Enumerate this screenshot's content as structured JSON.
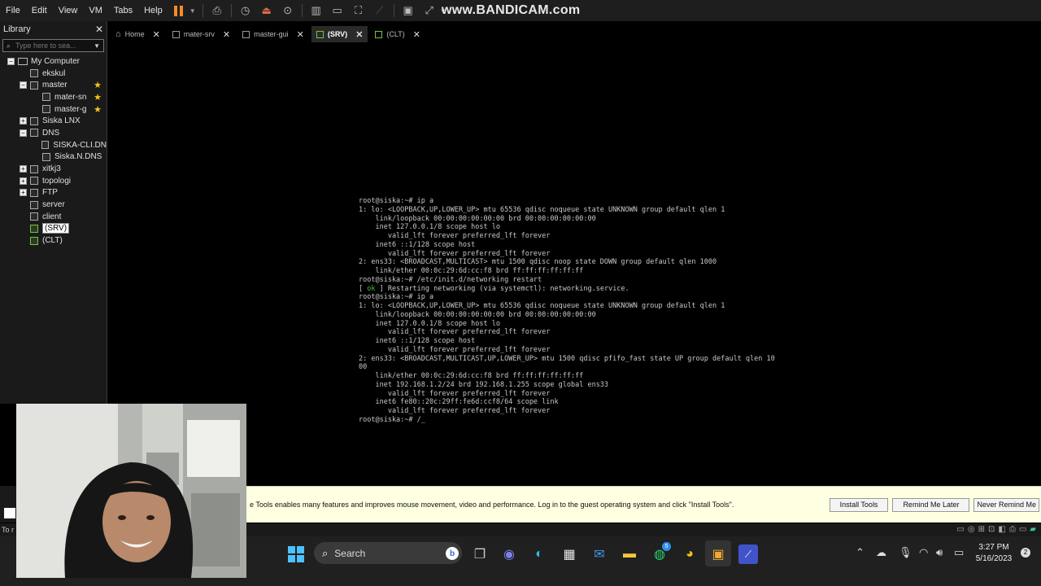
{
  "menubar": {
    "items": [
      "File",
      "Edit",
      "View",
      "VM",
      "Tabs",
      "Help"
    ],
    "watermark": "www.BANDICAM.com"
  },
  "library": {
    "title": "Library",
    "search_placeholder": "Type here to sea...",
    "tree": [
      {
        "label": "My Computer",
        "level": 0,
        "expander": "−",
        "icon": "computer-icon"
      },
      {
        "label": "ekskul",
        "level": 1,
        "expander": "",
        "icon": "vm-icon"
      },
      {
        "label": "master",
        "level": 1,
        "expander": "−",
        "icon": "vm-icon",
        "star": true
      },
      {
        "label": "mater-sn",
        "level": 2,
        "expander": "",
        "icon": "vm-icon",
        "star": true
      },
      {
        "label": "master-g",
        "level": 2,
        "expander": "",
        "icon": "vm-icon",
        "star": true
      },
      {
        "label": "Siska LNX",
        "level": 1,
        "expander": "+",
        "icon": "vm-icon"
      },
      {
        "label": "DNS",
        "level": 1,
        "expander": "−",
        "icon": "vm-icon"
      },
      {
        "label": "SISKA-CLI.DN",
        "level": 2,
        "expander": "",
        "icon": "vm-icon"
      },
      {
        "label": "Siska.N.DNS",
        "level": 2,
        "expander": "",
        "icon": "vm-icon"
      },
      {
        "label": "xitkj3",
        "level": 1,
        "expander": "+",
        "icon": "vm-icon"
      },
      {
        "label": "topologi",
        "level": 1,
        "expander": "+",
        "icon": "vm-icon"
      },
      {
        "label": "FTP",
        "level": 1,
        "expander": "+",
        "icon": "vm-icon"
      },
      {
        "label": "server",
        "level": 1,
        "expander": "",
        "icon": "vm-icon"
      },
      {
        "label": "client",
        "level": 1,
        "expander": "",
        "icon": "vm-icon"
      },
      {
        "label": "(SRV)",
        "level": 1,
        "expander": "",
        "icon": "vm-running-icon",
        "selected": true
      },
      {
        "label": "(CLT)",
        "level": 1,
        "expander": "",
        "icon": "vm-running-icon"
      }
    ]
  },
  "tabs": [
    {
      "label": "Home",
      "icon": "home-icon",
      "active": false
    },
    {
      "label": "mater-srv",
      "icon": "vm-icon",
      "active": false
    },
    {
      "label": "master-gui",
      "icon": "vm-icon",
      "active": false
    },
    {
      "label": "(SRV)",
      "icon": "vm-running-icon",
      "active": true
    },
    {
      "label": "(CLT)",
      "icon": "vm-running-icon",
      "active": false
    }
  ],
  "console": {
    "lines": [
      "root@siska:~# ip a",
      "1: lo: <LOOPBACK,UP,LOWER_UP> mtu 65536 qdisc noqueue state UNKNOWN group default qlen 1",
      "    link/loopback 00:00:00:00:00:00 brd 00:00:00:00:00:00",
      "    inet 127.0.0.1/8 scope host lo",
      "       valid_lft forever preferred_lft forever",
      "    inet6 ::1/128 scope host",
      "       valid_lft forever preferred_lft forever",
      "2: ens33: <BROADCAST,MULTICAST> mtu 1500 qdisc noop state DOWN group default qlen 1000",
      "    link/ether 00:0c:29:6d:cc:f8 brd ff:ff:ff:ff:ff:ff",
      "root@siska:~# /etc/init.d/networking restart",
      "[ ok ] Restarting networking (via systemctl): networking.service.",
      "root@siska:~# ip a",
      "1: lo: <LOOPBACK,UP,LOWER_UP> mtu 65536 qdisc noqueue state UNKNOWN group default qlen 1",
      "    link/loopback 00:00:00:00:00:00 brd 00:00:00:00:00:00",
      "    inet 127.0.0.1/8 scope host lo",
      "       valid_lft forever preferred_lft forever",
      "    inet6 ::1/128 scope host",
      "       valid_lft forever preferred_lft forever",
      "2: ens33: <BROADCAST,MULTICAST,UP,LOWER_UP> mtu 1500 qdisc pfifo_fast state UP group default qlen 10",
      "00",
      "    link/ether 00:0c:29:6d:cc:f8 brd ff:ff:ff:ff:ff:ff",
      "    inet 192.168.1.2/24 brd 192.168.1.255 scope global ens33",
      "       valid_lft forever preferred_lft forever",
      "    inet6 fe80::20c:29ff:fe6d:ccf8/64 scope link",
      "       valid_lft forever preferred_lft forever",
      "root@siska:~# /_"
    ]
  },
  "notification": {
    "text": "e Tools enables many features and improves mouse movement, video and performance. Log in to the guest operating system and click \"Install Tools\".",
    "install_label": "Install Tools",
    "remind_later_label": "Remind Me Later",
    "never_remind_label": "Never Remind Me"
  },
  "statusbar": {
    "text": "To r"
  },
  "taskbar": {
    "search_label": "Search",
    "whatsapp_badge": "5",
    "time": "3:27 PM",
    "date": "5/16/2023",
    "notification_count": "2"
  }
}
